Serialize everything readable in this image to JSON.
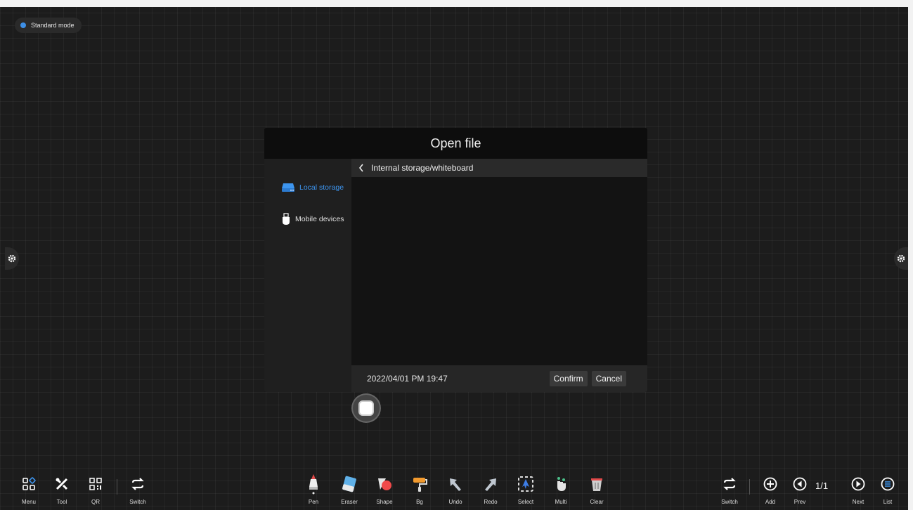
{
  "mode": {
    "label": "Standard mode"
  },
  "dialog": {
    "title": "Open file",
    "path": "Internal storage/whiteboard",
    "sources": [
      "Local storage",
      "Mobile devices"
    ],
    "timestamp": "2022/04/01 PM 19:47",
    "confirm_label": "Confirm",
    "cancel_label": "Cancel"
  },
  "toolbar": {
    "left": [
      "Menu",
      "Tool",
      "QR",
      "Switch"
    ],
    "center": [
      "Pen",
      "Eraser",
      "Shape",
      "Bg",
      "Undo",
      "Redo",
      "Select",
      "Multi",
      "Clear"
    ],
    "right": [
      "Switch",
      "Add",
      "Prev",
      "Next",
      "List"
    ],
    "page": "1/1"
  },
  "colors": {
    "accent": "#3d95ef",
    "background": "#1c1c1c"
  }
}
